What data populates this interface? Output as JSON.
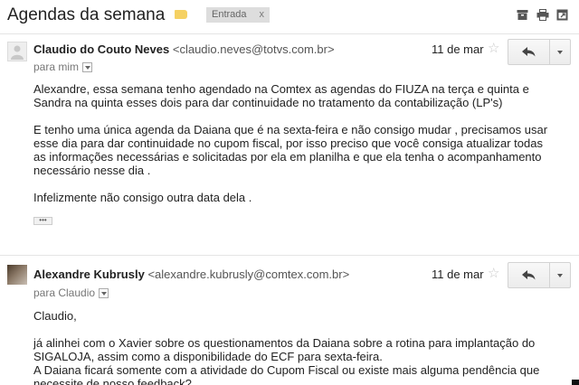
{
  "thread": {
    "title": "Agendas da semana",
    "label": "Entrada",
    "label_remove": "x",
    "icons": [
      "archive-icon",
      "print-icon",
      "new-window-icon"
    ],
    "colors": {
      "tag": "#f5d163"
    }
  },
  "messages": [
    {
      "sender_name": "Claudio do Couto Neves",
      "sender_email": "<claudio.neves@totvs.com.br>",
      "recipient": "para mim",
      "date": "11 de mar",
      "star": "☆",
      "body": [
        "Alexandre, essa semana tenho agendado na Comtex as agendas do FIUZA na terça e quinta e Sandra na quinta esses dois para dar continuidade no tratamento da contabilização (LP's)",
        "E tenho uma única agenda da Daiana que é na sexta-feira e não consigo mudar , precisamos usar esse dia para dar continuidade no cupom fiscal, por isso preciso que você consiga atualizar todas as informações necessárias e solicitadas por ela em planilha e que ela tenha o acompanhamento necessário nesse dia .",
        "Infelizmente não consigo outra data dela ."
      ],
      "trimmed": "•••"
    },
    {
      "sender_name": "Alexandre Kubrusly",
      "sender_email": "<alexandre.kubrusly@comtex.com.br>",
      "recipient": "para Claudio",
      "date": "11 de mar",
      "star": "☆",
      "greeting": "Claudio,",
      "body": [
        "já alinhei com o Xavier sobre os questionamentos da Daiana sobre a rotina para implantação do SIGALOJA, assim como a disponibilidade do ECF para sexta-feira.",
        "A Daiana ficará somente com a atividade do Cupom Fiscal ou existe mais alguma pendência que necessite de nosso feedback?"
      ]
    }
  ]
}
